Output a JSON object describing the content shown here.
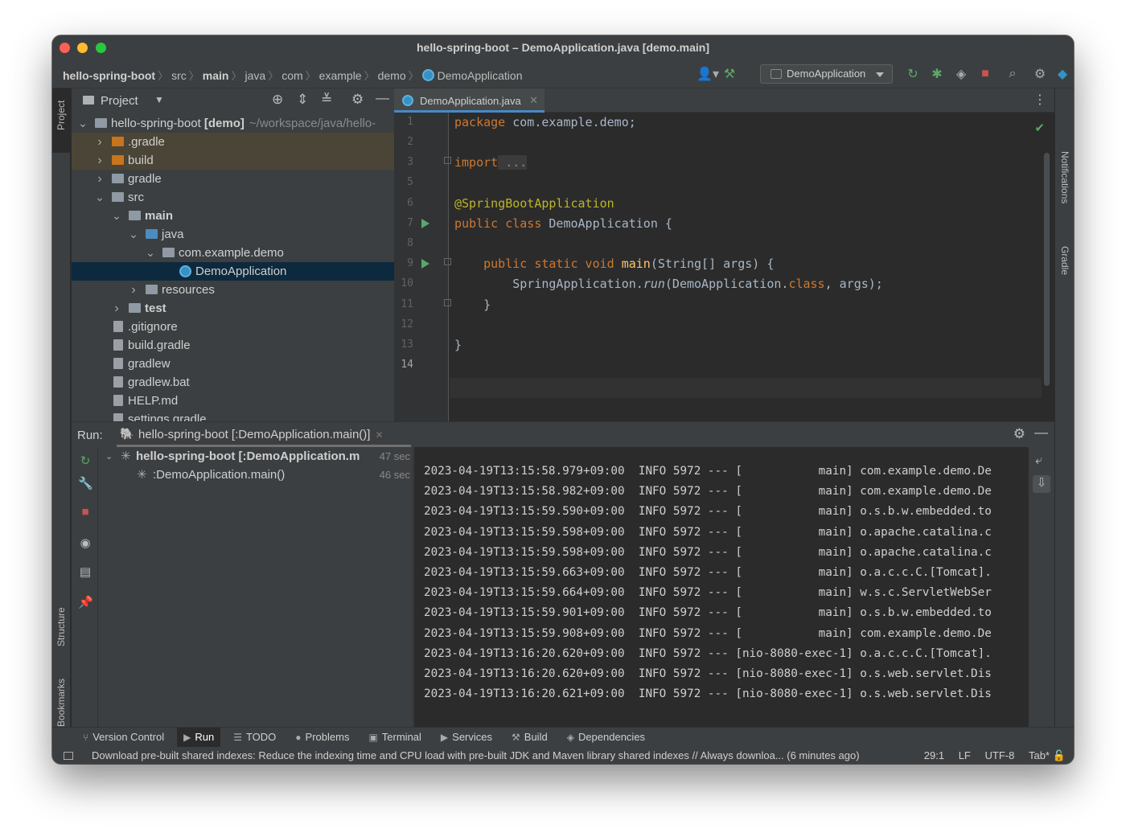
{
  "window": {
    "title": "hello-spring-boot – DemoApplication.java [demo.main]"
  },
  "navbar": {
    "crumbs": [
      "hello-spring-boot",
      "src",
      "main",
      "java",
      "com",
      "example",
      "demo",
      "DemoApplication"
    ],
    "run_config": "DemoApplication",
    "icons": [
      "user-icon",
      "build-hammer-icon",
      "rerun-icon",
      "debug-icon",
      "coverage-icon",
      "stop-icon",
      "search-icon",
      "settings-icon",
      "plugin-icon"
    ]
  },
  "left_strip": {
    "project_label": "Project",
    "structure_label": "Structure",
    "bookmarks_label": "Bookmarks"
  },
  "right_strip": {
    "notifications_label": "Notifications",
    "gradle_label": "Gradle"
  },
  "project_panel": {
    "title": "Project",
    "tree": [
      {
        "label": "hello-spring-boot",
        "bold_suffix": "[demo]",
        "path": "~/workspace/java/hello-",
        "indent": 0,
        "chevron": "down",
        "icon": "folder-g"
      },
      {
        "label": ".gradle",
        "indent": 1,
        "chevron": "right",
        "icon": "folder-o",
        "highlight": true
      },
      {
        "label": "build",
        "indent": 1,
        "chevron": "right",
        "icon": "folder-o",
        "highlight": true
      },
      {
        "label": "gradle",
        "indent": 1,
        "chevron": "right",
        "icon": "folder-g"
      },
      {
        "label": "src",
        "indent": 1,
        "chevron": "down",
        "icon": "folder-g"
      },
      {
        "label": "main",
        "indent": 2,
        "chevron": "down",
        "icon": "folder-g",
        "bold": true
      },
      {
        "label": "java",
        "indent": 3,
        "chevron": "down",
        "icon": "folder-b"
      },
      {
        "label": "com.example.demo",
        "indent": 4,
        "chevron": "down",
        "icon": "folder-g"
      },
      {
        "label": "DemoApplication",
        "indent": 5,
        "chevron": "",
        "icon": "class",
        "selected": true
      },
      {
        "label": "resources",
        "indent": 3,
        "chevron": "right",
        "icon": "folder-g"
      },
      {
        "label": "test",
        "indent": 2,
        "chevron": "right",
        "icon": "folder-g",
        "bold": true
      },
      {
        "label": ".gitignore",
        "indent": 1,
        "chevron": "",
        "icon": "file"
      },
      {
        "label": "build.gradle",
        "indent": 1,
        "chevron": "",
        "icon": "file"
      },
      {
        "label": "gradlew",
        "indent": 1,
        "chevron": "",
        "icon": "file"
      },
      {
        "label": "gradlew.bat",
        "indent": 1,
        "chevron": "",
        "icon": "file"
      },
      {
        "label": "HELP.md",
        "indent": 1,
        "chevron": "",
        "icon": "file"
      },
      {
        "label": "settings.gradle",
        "indent": 1,
        "chevron": "",
        "icon": "file"
      }
    ]
  },
  "editor": {
    "tab_label": "DemoApplication.java",
    "current_line": 14,
    "line_numbers": [
      "1",
      "2",
      "3",
      "5",
      "6",
      "7",
      "8",
      "9",
      "10",
      "11",
      "12",
      "13",
      "14"
    ],
    "code": {
      "l1_kw": "package",
      "l1_rest": " com.example.demo;",
      "l3_kw": "import",
      "l3_rest": " ...",
      "l6": "@SpringBootApplication",
      "l7_kw": "public class",
      "l7_rest": " DemoApplication {",
      "l9_kw": "    public static void",
      "l9_fn": " main",
      "l9_rest": "(String[] args) {",
      "l10_a": "        SpringApplication.",
      "l10_run": "run",
      "l10_b": "(DemoApplication.",
      "l10_cls": "class",
      "l10_c": ", args);",
      "l11": "    }",
      "l13": "}"
    }
  },
  "run_panel": {
    "label": "Run:",
    "tab": "hello-spring-boot [:DemoApplication.main()]",
    "tree": [
      {
        "label": "hello-spring-boot [:DemoApplication.m",
        "time": "47 sec"
      },
      {
        "label": ":DemoApplication.main()",
        "time": "46 sec"
      }
    ],
    "log": [
      "2023-04-19T13:15:58.979+09:00  INFO 5972 --- [           main] com.example.demo.De",
      "2023-04-19T13:15:58.982+09:00  INFO 5972 --- [           main] com.example.demo.De",
      "2023-04-19T13:15:59.590+09:00  INFO 5972 --- [           main] o.s.b.w.embedded.to",
      "2023-04-19T13:15:59.598+09:00  INFO 5972 --- [           main] o.apache.catalina.c",
      "2023-04-19T13:15:59.598+09:00  INFO 5972 --- [           main] o.apache.catalina.c",
      "2023-04-19T13:15:59.663+09:00  INFO 5972 --- [           main] o.a.c.c.C.[Tomcat].",
      "2023-04-19T13:15:59.664+09:00  INFO 5972 --- [           main] w.s.c.ServletWebSer",
      "2023-04-19T13:15:59.901+09:00  INFO 5972 --- [           main] o.s.b.w.embedded.to",
      "2023-04-19T13:15:59.908+09:00  INFO 5972 --- [           main] com.example.demo.De",
      "2023-04-19T13:16:20.620+09:00  INFO 5972 --- [nio-8080-exec-1] o.a.c.c.C.[Tomcat].",
      "2023-04-19T13:16:20.620+09:00  INFO 5972 --- [nio-8080-exec-1] o.s.web.servlet.Dis",
      "2023-04-19T13:16:20.621+09:00  INFO 5972 --- [nio-8080-exec-1] o.s.web.servlet.Dis"
    ]
  },
  "tool_tabs": [
    {
      "label": "Version Control",
      "icon": "⑂"
    },
    {
      "label": "Run",
      "icon": "▶",
      "active": true
    },
    {
      "label": "TODO",
      "icon": "☰"
    },
    {
      "label": "Problems",
      "icon": "●"
    },
    {
      "label": "Terminal",
      "icon": "▣"
    },
    {
      "label": "Services",
      "icon": "▶"
    },
    {
      "label": "Build",
      "icon": "⚒"
    },
    {
      "label": "Dependencies",
      "icon": "◈"
    }
  ],
  "status": {
    "message": "Download pre-built shared indexes: Reduce the indexing time and CPU load with pre-built JDK and Maven library shared indexes // Always downloa... (6 minutes ago)",
    "position": "29:1",
    "line_sep": "LF",
    "encoding": "UTF-8",
    "indent": "Tab*"
  },
  "colors": {
    "keyword": "#cc7832",
    "annotation": "#bbb529",
    "function": "#ffc66d",
    "run_green": "#59a869",
    "stop_red": "#c75450"
  }
}
